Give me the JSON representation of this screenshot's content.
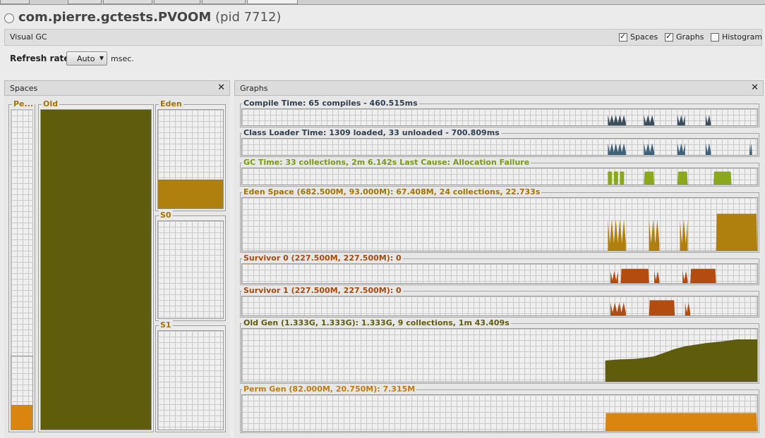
{
  "window": {
    "app_name": "com.pierre.gctests.PVOOM",
    "pid_text": "(pid 7712)"
  },
  "visual_gc_bar": {
    "title": "Visual GC",
    "options": [
      {
        "label": "Spaces",
        "checked": true
      },
      {
        "label": "Graphs",
        "checked": true
      },
      {
        "label": "Histogram",
        "checked": false
      }
    ]
  },
  "refresh": {
    "label": "Refresh rate:",
    "value": "Auto",
    "unit": "msec."
  },
  "spaces_panel": {
    "title": "Spaces",
    "perm": {
      "label": "Pe...",
      "capacity_fraction": 0.23,
      "used_fraction": 0.34
    },
    "old": {
      "label": "Old",
      "used_fraction": 1.0
    },
    "eden": {
      "label": "Eden",
      "used_fraction": 0.29
    },
    "s0": {
      "label": "S0",
      "used_fraction": 0.0
    },
    "s1": {
      "label": "S1",
      "used_fraction": 0.0
    }
  },
  "graphs_panel": {
    "title": "Graphs",
    "graphs": [
      {
        "key": "compile",
        "label": "Compile Time: 65 compiles - 460.515ms",
        "color": "#3c4e5e",
        "label_color": "#2f3f4f"
      },
      {
        "key": "classloader",
        "label": "Class Loader Time: 1309 loaded, 33 unloaded - 700.809ms",
        "color": "#3f6278",
        "label_color": "#2f3f4f"
      },
      {
        "key": "gc",
        "label": "GC Time: 33 collections, 2m 6.142s  Last Cause: Allocation Failure",
        "color": "#8aa81a",
        "label_color": "#7a9a10"
      },
      {
        "key": "eden",
        "label": "Eden Space (682.500M, 93.000M): 67.408M, 24 collections, 22.733s",
        "color": "#b0800f",
        "label_color": "#a37400"
      },
      {
        "key": "s0",
        "label": "Survivor 0 (227.500M, 227.500M): 0",
        "color": "#b44c10",
        "label_color": "#a74a0a"
      },
      {
        "key": "s1",
        "label": "Survivor 1 (227.500M, 227.500M): 0",
        "color": "#b44c10",
        "label_color": "#a74a0a"
      },
      {
        "key": "old",
        "label": "Old Gen (1.333G, 1.333G): 1.333G, 9 collections, 1m 43.409s",
        "color": "#5f5c0c",
        "label_color": "#5f5c0c"
      },
      {
        "key": "perm",
        "label": "Perm Gen (82.000M, 20.750M): 7.315M",
        "color": "#d9850f",
        "label_color": "#c37a0a"
      }
    ]
  }
}
